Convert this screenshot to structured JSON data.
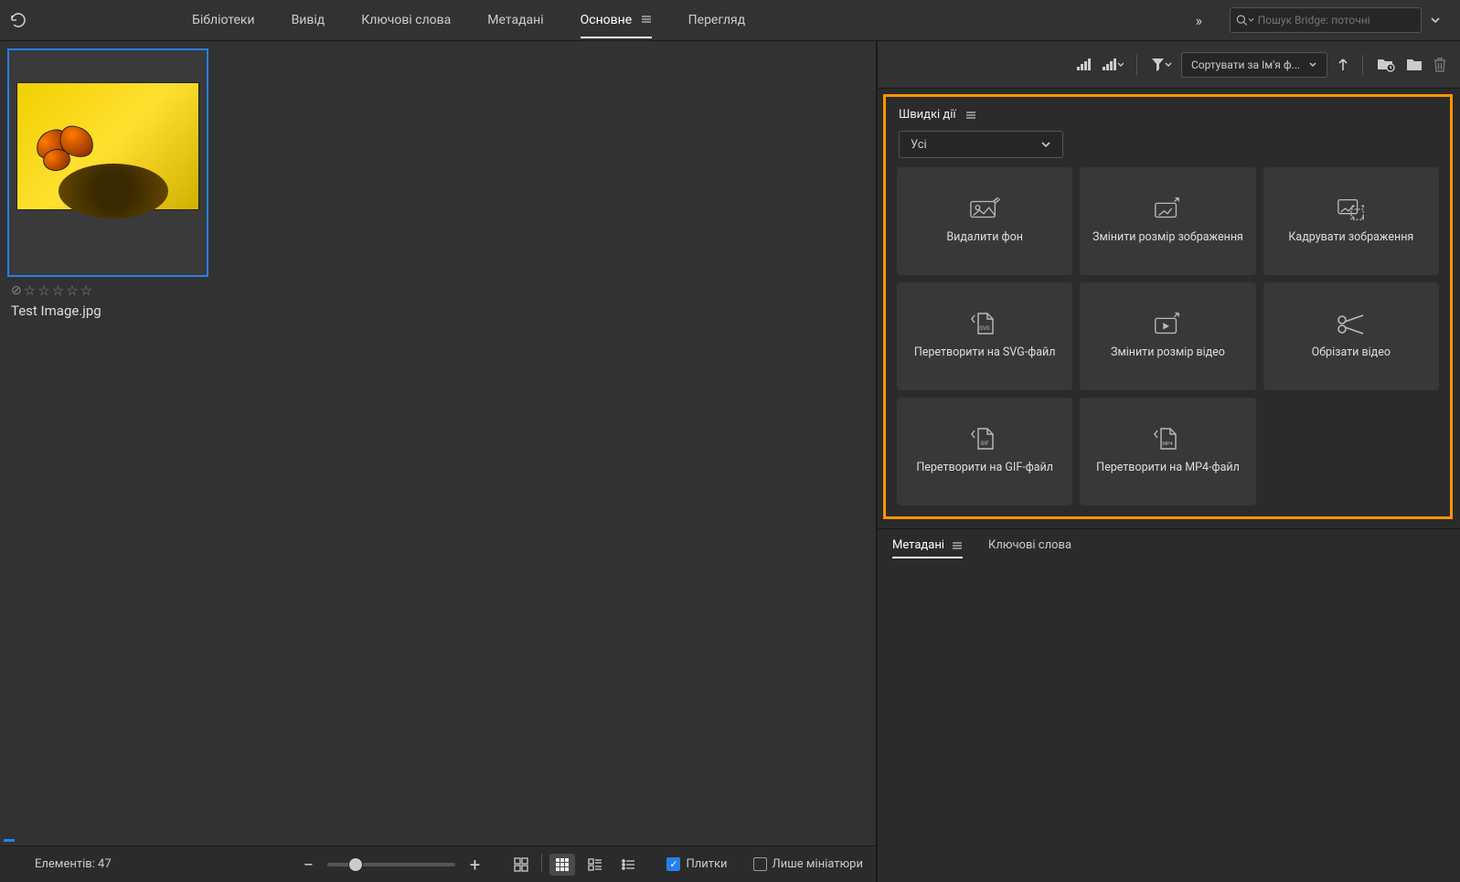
{
  "topbar": {
    "tabs": [
      "Бібліотеки",
      "Вивід",
      "Ключові слова",
      "Метадані",
      "Основне",
      "Перегляд"
    ],
    "active_tab": 4,
    "search_placeholder": "Пошук Bridge: поточні"
  },
  "content": {
    "thumbnail_filename": "Test Image.jpg",
    "rating": 0
  },
  "bottom": {
    "item_count_label": "Елементів: 47",
    "tiles_label": "Плитки",
    "thumbs_only_label": "Лише мініатюри",
    "tiles_checked": true,
    "thumbs_only_checked": false
  },
  "right_toolbar": {
    "sort_label": "Сортувати за Ім'я ф..."
  },
  "quick_actions": {
    "title": "Швидкі дії",
    "filter_value": "Усі",
    "tiles": [
      {
        "label": "Видалити фон"
      },
      {
        "label": "Змінити розмір зображення"
      },
      {
        "label": "Кадрувати зображення"
      },
      {
        "label": "Перетворити на SVG-файл"
      },
      {
        "label": "Змінити розмір відео"
      },
      {
        "label": "Обрізати відео"
      },
      {
        "label": "Перетворити на GIF-файл"
      },
      {
        "label": "Перетворити на MP4-файл"
      }
    ]
  },
  "meta_panel": {
    "tabs": [
      "Метадані",
      "Ключові слова"
    ],
    "active_tab": 0
  }
}
